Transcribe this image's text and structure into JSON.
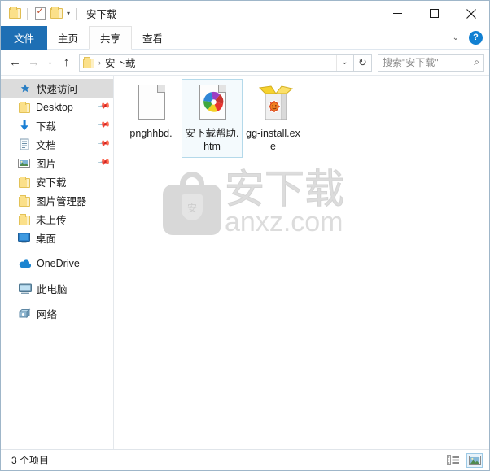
{
  "window": {
    "title": "安下载",
    "quick_access_toolbar": [
      {
        "name": "folder-properties-icon",
        "label": ""
      },
      {
        "name": "properties-check-icon",
        "label": ""
      },
      {
        "name": "new-folder-icon",
        "label": ""
      },
      {
        "name": "customize-caret-icon",
        "label": "▾"
      }
    ],
    "controls": {
      "minimize": "—",
      "maximize": "□",
      "close": "✕"
    }
  },
  "ribbon": {
    "tabs": [
      {
        "label": "文件",
        "state": "file-menu"
      },
      {
        "label": "主页",
        "state": "normal"
      },
      {
        "label": "共享",
        "state": "hover"
      },
      {
        "label": "查看",
        "state": "normal"
      }
    ],
    "expand_caret": "⌄",
    "help_label": "?"
  },
  "address_bar": {
    "back_label": "←",
    "forward_label": "→",
    "recent_label": "⌄",
    "up_label": "↑",
    "breadcrumb_separator": "›",
    "breadcrumb": "安下载",
    "dropdown_label": "⌄",
    "refresh_label": "↻",
    "search_placeholder": "搜索\"安下载\"",
    "search_icon": "⌕"
  },
  "sidebar": {
    "items": [
      {
        "label": "快速访问",
        "icon": "pin-star-icon",
        "selected": true,
        "pinned": false,
        "indent": "root",
        "spacer": false
      },
      {
        "label": "Desktop",
        "icon": "folder-icon",
        "selected": false,
        "pinned": true,
        "indent": "child",
        "spacer": false
      },
      {
        "label": "下载",
        "icon": "download-arrow-icon",
        "selected": false,
        "pinned": true,
        "indent": "child",
        "spacer": false
      },
      {
        "label": "文档",
        "icon": "documents-icon",
        "selected": false,
        "pinned": true,
        "indent": "child",
        "spacer": false
      },
      {
        "label": "图片",
        "icon": "pictures-icon",
        "selected": false,
        "pinned": true,
        "indent": "child",
        "spacer": false
      },
      {
        "label": "安下载",
        "icon": "folder-icon",
        "selected": false,
        "pinned": false,
        "indent": "child",
        "spacer": false
      },
      {
        "label": "图片管理器",
        "icon": "folder-icon",
        "selected": false,
        "pinned": false,
        "indent": "child",
        "spacer": false
      },
      {
        "label": "未上传",
        "icon": "folder-icon",
        "selected": false,
        "pinned": false,
        "indent": "child",
        "spacer": false
      },
      {
        "label": "桌面",
        "icon": "desktop-icon",
        "selected": false,
        "pinned": false,
        "indent": "child",
        "spacer": false
      },
      {
        "label": "OneDrive",
        "icon": "onedrive-cloud-icon",
        "selected": false,
        "pinned": false,
        "indent": "root",
        "spacer": true
      },
      {
        "label": "此电脑",
        "icon": "this-pc-icon",
        "selected": false,
        "pinned": false,
        "indent": "root",
        "spacer": true
      },
      {
        "label": "网络",
        "icon": "network-icon",
        "selected": false,
        "pinned": false,
        "indent": "root",
        "spacer": true
      }
    ]
  },
  "files": [
    {
      "name": "pnghhbd.",
      "icon": "generic-document-icon",
      "selected": false
    },
    {
      "name": "安下载帮助.htm",
      "icon": "html-browser-document-icon",
      "selected": true
    },
    {
      "name": "gg-install.exe",
      "icon": "installer-package-icon",
      "selected": false
    }
  ],
  "watermark": {
    "logo_icon": "anxz-bag-shield-logo",
    "shield_char": "安",
    "chinese_text": "安下载",
    "domain_text": "anxz.com"
  },
  "status_bar": {
    "item_count_text": "3 个项目",
    "views": [
      {
        "name": "details-view-button",
        "active": false
      },
      {
        "name": "large-icons-view-button",
        "active": true
      }
    ]
  },
  "colors": {
    "accent_blue": "#1e6fb4",
    "help_blue": "#1180d2",
    "folder_yellow": "#fbe08a",
    "selection_bg": "#f4fafd",
    "selection_border": "#b4d9ea",
    "sidebar_selected_bg": "#dcdcdc",
    "watermark_gray": "#dcdcdc"
  }
}
